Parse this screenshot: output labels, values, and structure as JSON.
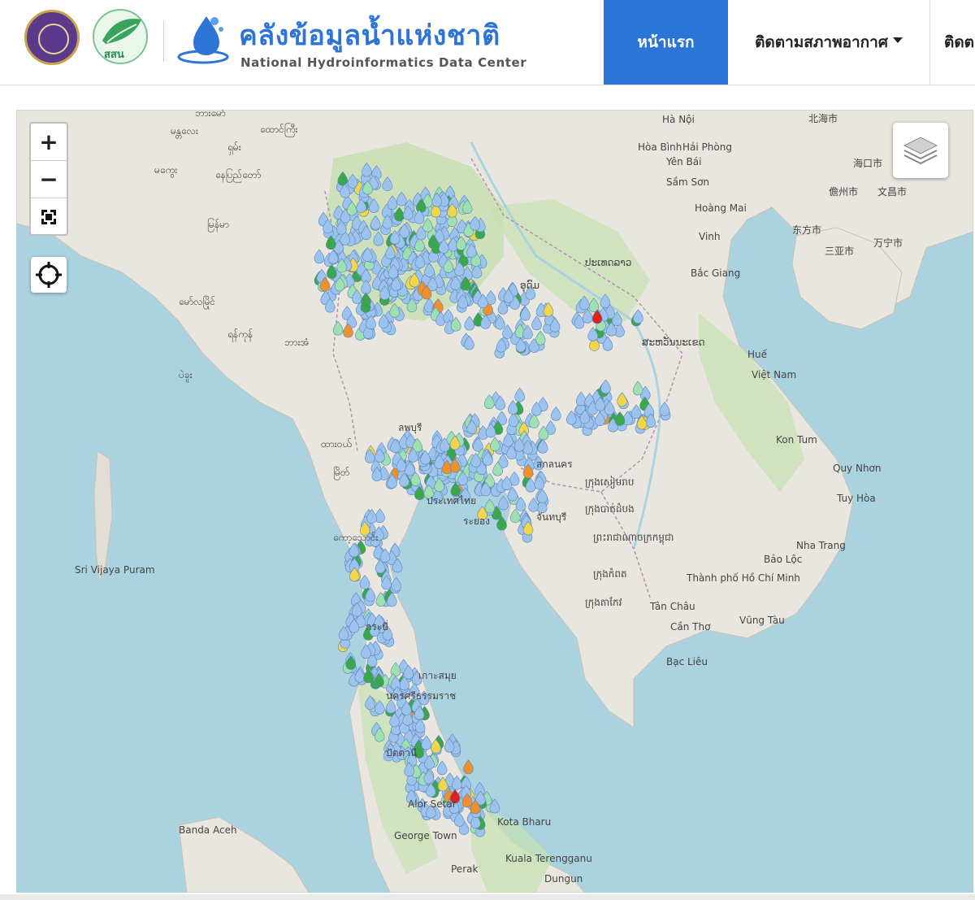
{
  "header": {
    "brand_title_th": "คลังข้อมูลน้ำแห่งชาติ",
    "brand_subtitle_en": "National Hydroinformatics Data Center",
    "partner_logo_text": "สสน"
  },
  "nav": {
    "home_label": "หน้าแรก",
    "weather_label": "ติดตามสภาพอากาศ",
    "next_label": "ติดต"
  },
  "map_controls": {
    "zoom_in": "+",
    "zoom_out": "−"
  },
  "map": {
    "labels": [
      "ဘားမော်",
      "မန္တလေး",
      "ထောင်ကြီး",
      "ရှမ်း",
      "နေပြည်တော်",
      "မကွေး",
      "ရန်ကုန်",
      "မြန်မာ",
      "မော်လမြိုင်",
      "ထားဝယ်",
      "မြိတ်",
      "ကော့သောင်း",
      "ဘားအံ",
      "ပဲခူး",
      "Hà Nội",
      "Hải Phòng",
      "Hòa Bình",
      "Yên Bái",
      "Sầm Sơn",
      "Hoàng Mai",
      "Vinh",
      "Bắc Giang",
      "ປະເທດລາວ",
      "ສະຫວັນນະເຂດ",
      "ອຸດົມ",
      "Huế",
      "Việt Nam",
      "Kon Tum",
      "Quy Nhơn",
      "Tuy Hòa",
      "Nha Trang",
      "Bảo Lộc",
      "Thành phố Hồ Chí Minh",
      "Tân Châu",
      "Cần Thơ",
      "Bạc Liêu",
      "Vũng Tàu",
      "ក្រុងសៀមរាប",
      "ក្រុងបាត់ដំបង",
      "ព្រះរាជាណាចក្រកម្ពុជា",
      "ក្រុងកំពត",
      "ក្រុងតាកែវ",
      "Banda Aceh",
      "George Town",
      "Alor Setar",
      "Kota Bharu",
      "Kuala Terengganu",
      "Dungun",
      "Perak",
      "北海市",
      "海口市",
      "儋州市",
      "三亚市",
      "文昌市",
      "东方市",
      "万宁市",
      "Sri Vijaya Puram",
      "ประเทศไทย",
      "ระยอง",
      "ลพบุรี",
      "สกลนคร",
      "จันทบุรี",
      "กระบี่",
      "นครศรีธรรมราช",
      "ปัตตานี",
      "เกาะสมุย"
    ],
    "station_legend_colors": {
      "normal": "#9cc3ee",
      "low": "#9fe0b2",
      "moderate": "#3aa84a",
      "high": "#f3d54a",
      "very_high": "#f0902a",
      "critical": "#e02020"
    }
  }
}
